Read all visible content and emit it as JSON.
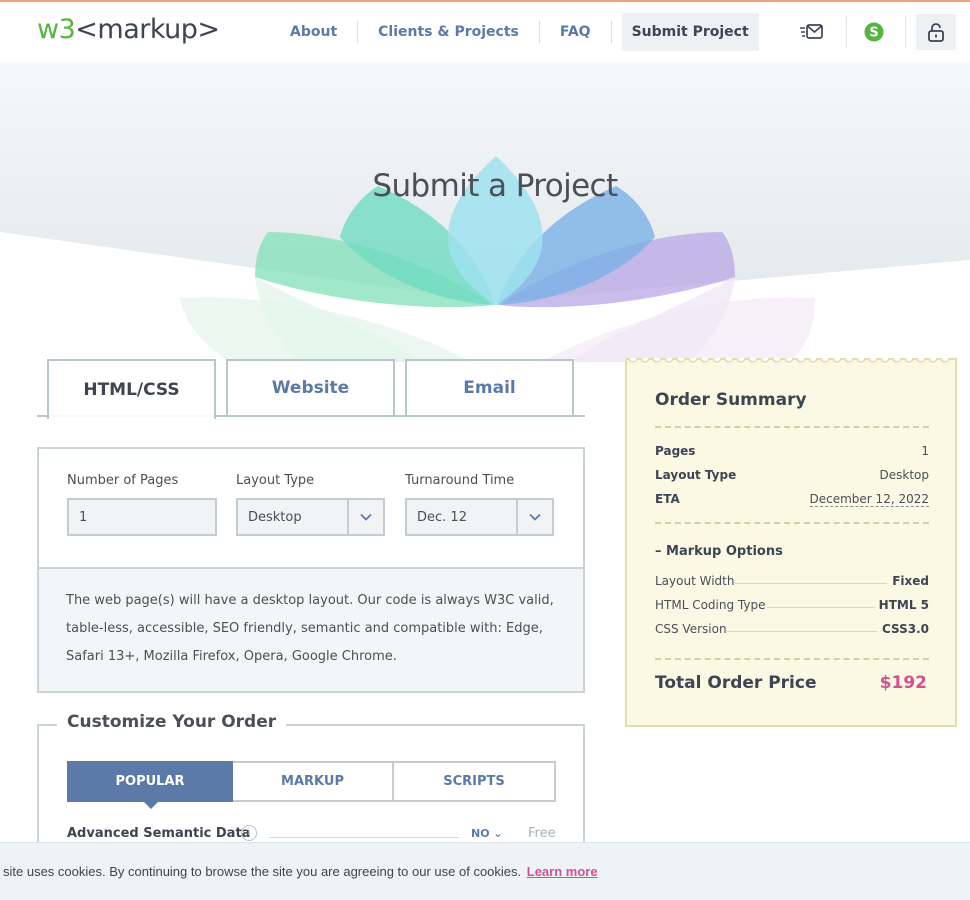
{
  "header": {
    "logo_w3": "w3",
    "logo_markup": "<markup>",
    "nav": [
      "About",
      "Clients & Projects",
      "FAQ",
      "Submit Project"
    ],
    "active_nav": "Submit Project",
    "icons": [
      "mail-icon",
      "skype-icon",
      "lock-icon"
    ]
  },
  "hero": {
    "title": "Submit a Project"
  },
  "tabs": [
    "HTML/CSS",
    "Website",
    "Email"
  ],
  "form": {
    "pages_label": "Number of Pages",
    "pages_value": "1",
    "layout_label": "Layout Type",
    "layout_value": "Desktop",
    "turnaround_label": "Turnaround Time",
    "turnaround_value": "Dec. 12"
  },
  "description": "The web page(s) will have a desktop layout. Our code is always W3C valid, table-less, accessible, SEO friendly, semantic and compatible with: Edge, Safari 13+, Mozilla Firefox, Opera, Google Chrome.",
  "customize": {
    "title": "Customize Your Order",
    "subtabs": [
      "POPULAR",
      "MARKUP",
      "SCRIPTS"
    ],
    "option": {
      "name": "Advanced Semantic Data",
      "info": "i",
      "value": "NO",
      "price": "Free"
    }
  },
  "summary": {
    "title": "Order Summary",
    "rows": [
      {
        "k": "Pages",
        "v": "1"
      },
      {
        "k": "Layout Type",
        "v": "Desktop"
      },
      {
        "k": "ETA",
        "v": "December 12, 2022"
      }
    ],
    "markup_title": "– Markup Options",
    "options": [
      {
        "k": "Layout Width",
        "v": "Fixed"
      },
      {
        "k": "HTML Coding Type",
        "v": "HTML 5"
      },
      {
        "k": "CSS Version",
        "v": "CSS3.0"
      }
    ],
    "total_label": "Total Order Price",
    "total_value": "$192"
  },
  "cookie": {
    "text": "is site uses cookies. By continuing to browse the site you are agreeing to our use of cookies.",
    "link": "Learn more"
  },
  "colors": {
    "brand_green": "#55b53e",
    "link_blue": "#5b7aa8",
    "price_pink": "#d1518e",
    "summary_bg": "#fbf8e3"
  }
}
